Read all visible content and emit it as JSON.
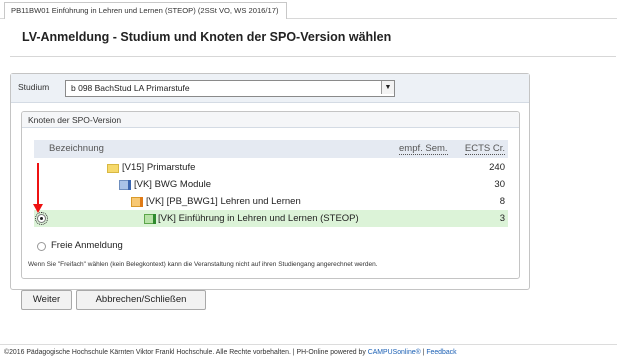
{
  "tab": {
    "label": "PB11BW01 Einführung in Lehren und Lernen (STEOP) (2SSt VO, WS 2016/17)"
  },
  "page_title": "LV-Anmeldung - Studium und Knoten der SPO-Version wählen",
  "studium": {
    "label": "Studium",
    "selected": "b 098 BachStud LA Primarstufe"
  },
  "knoten": {
    "title": "Knoten der SPO-Version",
    "columns": {
      "bezeichnung": "Bezeichnung",
      "empf_sem": "empf. Sem.",
      "ects": "ECTS Cr."
    },
    "rows": [
      {
        "label": "[V15] Primarstufe",
        "ects": "240"
      },
      {
        "label": "[VK] BWG Module",
        "ects": "30"
      },
      {
        "label": "[VK] [PB_BWG1] Lehren und Lernen",
        "ects": "8"
      },
      {
        "label": "[VK] Einführung in Lehren und Lernen (STEOP)",
        "ects": "3"
      }
    ],
    "freie_anmeldung": "Freie Anmeldung",
    "hinweis": "Wenn Sie \"Freifach\" wählen (kein Belegkontext) kann die Veranstaltung nicht auf ihren Studiengang angerechnet werden."
  },
  "buttons": {
    "weiter": "Weiter",
    "abbrechen": "Abbrechen/Schließen"
  },
  "footer": {
    "text": "©2016 Pädagogische Hochschule Kärnten Viktor Frankl Hochschule. Alle Rechte vorbehalten. | PH-Online powered by ",
    "link_campus": "CAMPUSonline®",
    "sep": " | ",
    "link_feedback": "Feedback"
  }
}
